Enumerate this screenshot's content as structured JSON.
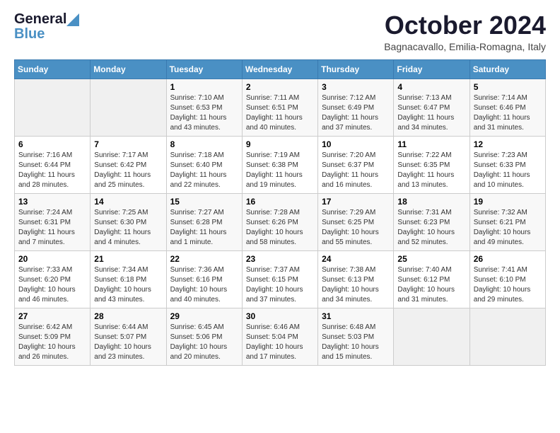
{
  "header": {
    "logo_general": "General",
    "logo_blue": "Blue",
    "month_title": "October 2024",
    "location": "Bagnacavallo, Emilia-Romagna, Italy"
  },
  "days_of_week": [
    "Sunday",
    "Monday",
    "Tuesday",
    "Wednesday",
    "Thursday",
    "Friday",
    "Saturday"
  ],
  "weeks": [
    [
      {
        "day": "",
        "sunrise": "",
        "sunset": "",
        "daylight": ""
      },
      {
        "day": "",
        "sunrise": "",
        "sunset": "",
        "daylight": ""
      },
      {
        "day": "1",
        "sunrise": "Sunrise: 7:10 AM",
        "sunset": "Sunset: 6:53 PM",
        "daylight": "Daylight: 11 hours and 43 minutes."
      },
      {
        "day": "2",
        "sunrise": "Sunrise: 7:11 AM",
        "sunset": "Sunset: 6:51 PM",
        "daylight": "Daylight: 11 hours and 40 minutes."
      },
      {
        "day": "3",
        "sunrise": "Sunrise: 7:12 AM",
        "sunset": "Sunset: 6:49 PM",
        "daylight": "Daylight: 11 hours and 37 minutes."
      },
      {
        "day": "4",
        "sunrise": "Sunrise: 7:13 AM",
        "sunset": "Sunset: 6:47 PM",
        "daylight": "Daylight: 11 hours and 34 minutes."
      },
      {
        "day": "5",
        "sunrise": "Sunrise: 7:14 AM",
        "sunset": "Sunset: 6:46 PM",
        "daylight": "Daylight: 11 hours and 31 minutes."
      }
    ],
    [
      {
        "day": "6",
        "sunrise": "Sunrise: 7:16 AM",
        "sunset": "Sunset: 6:44 PM",
        "daylight": "Daylight: 11 hours and 28 minutes."
      },
      {
        "day": "7",
        "sunrise": "Sunrise: 7:17 AM",
        "sunset": "Sunset: 6:42 PM",
        "daylight": "Daylight: 11 hours and 25 minutes."
      },
      {
        "day": "8",
        "sunrise": "Sunrise: 7:18 AM",
        "sunset": "Sunset: 6:40 PM",
        "daylight": "Daylight: 11 hours and 22 minutes."
      },
      {
        "day": "9",
        "sunrise": "Sunrise: 7:19 AM",
        "sunset": "Sunset: 6:38 PM",
        "daylight": "Daylight: 11 hours and 19 minutes."
      },
      {
        "day": "10",
        "sunrise": "Sunrise: 7:20 AM",
        "sunset": "Sunset: 6:37 PM",
        "daylight": "Daylight: 11 hours and 16 minutes."
      },
      {
        "day": "11",
        "sunrise": "Sunrise: 7:22 AM",
        "sunset": "Sunset: 6:35 PM",
        "daylight": "Daylight: 11 hours and 13 minutes."
      },
      {
        "day": "12",
        "sunrise": "Sunrise: 7:23 AM",
        "sunset": "Sunset: 6:33 PM",
        "daylight": "Daylight: 11 hours and 10 minutes."
      }
    ],
    [
      {
        "day": "13",
        "sunrise": "Sunrise: 7:24 AM",
        "sunset": "Sunset: 6:31 PM",
        "daylight": "Daylight: 11 hours and 7 minutes."
      },
      {
        "day": "14",
        "sunrise": "Sunrise: 7:25 AM",
        "sunset": "Sunset: 6:30 PM",
        "daylight": "Daylight: 11 hours and 4 minutes."
      },
      {
        "day": "15",
        "sunrise": "Sunrise: 7:27 AM",
        "sunset": "Sunset: 6:28 PM",
        "daylight": "Daylight: 11 hours and 1 minute."
      },
      {
        "day": "16",
        "sunrise": "Sunrise: 7:28 AM",
        "sunset": "Sunset: 6:26 PM",
        "daylight": "Daylight: 10 hours and 58 minutes."
      },
      {
        "day": "17",
        "sunrise": "Sunrise: 7:29 AM",
        "sunset": "Sunset: 6:25 PM",
        "daylight": "Daylight: 10 hours and 55 minutes."
      },
      {
        "day": "18",
        "sunrise": "Sunrise: 7:31 AM",
        "sunset": "Sunset: 6:23 PM",
        "daylight": "Daylight: 10 hours and 52 minutes."
      },
      {
        "day": "19",
        "sunrise": "Sunrise: 7:32 AM",
        "sunset": "Sunset: 6:21 PM",
        "daylight": "Daylight: 10 hours and 49 minutes."
      }
    ],
    [
      {
        "day": "20",
        "sunrise": "Sunrise: 7:33 AM",
        "sunset": "Sunset: 6:20 PM",
        "daylight": "Daylight: 10 hours and 46 minutes."
      },
      {
        "day": "21",
        "sunrise": "Sunrise: 7:34 AM",
        "sunset": "Sunset: 6:18 PM",
        "daylight": "Daylight: 10 hours and 43 minutes."
      },
      {
        "day": "22",
        "sunrise": "Sunrise: 7:36 AM",
        "sunset": "Sunset: 6:16 PM",
        "daylight": "Daylight: 10 hours and 40 minutes."
      },
      {
        "day": "23",
        "sunrise": "Sunrise: 7:37 AM",
        "sunset": "Sunset: 6:15 PM",
        "daylight": "Daylight: 10 hours and 37 minutes."
      },
      {
        "day": "24",
        "sunrise": "Sunrise: 7:38 AM",
        "sunset": "Sunset: 6:13 PM",
        "daylight": "Daylight: 10 hours and 34 minutes."
      },
      {
        "day": "25",
        "sunrise": "Sunrise: 7:40 AM",
        "sunset": "Sunset: 6:12 PM",
        "daylight": "Daylight: 10 hours and 31 minutes."
      },
      {
        "day": "26",
        "sunrise": "Sunrise: 7:41 AM",
        "sunset": "Sunset: 6:10 PM",
        "daylight": "Daylight: 10 hours and 29 minutes."
      }
    ],
    [
      {
        "day": "27",
        "sunrise": "Sunrise: 6:42 AM",
        "sunset": "Sunset: 5:09 PM",
        "daylight": "Daylight: 10 hours and 26 minutes."
      },
      {
        "day": "28",
        "sunrise": "Sunrise: 6:44 AM",
        "sunset": "Sunset: 5:07 PM",
        "daylight": "Daylight: 10 hours and 23 minutes."
      },
      {
        "day": "29",
        "sunrise": "Sunrise: 6:45 AM",
        "sunset": "Sunset: 5:06 PM",
        "daylight": "Daylight: 10 hours and 20 minutes."
      },
      {
        "day": "30",
        "sunrise": "Sunrise: 6:46 AM",
        "sunset": "Sunset: 5:04 PM",
        "daylight": "Daylight: 10 hours and 17 minutes."
      },
      {
        "day": "31",
        "sunrise": "Sunrise: 6:48 AM",
        "sunset": "Sunset: 5:03 PM",
        "daylight": "Daylight: 10 hours and 15 minutes."
      },
      {
        "day": "",
        "sunrise": "",
        "sunset": "",
        "daylight": ""
      },
      {
        "day": "",
        "sunrise": "",
        "sunset": "",
        "daylight": ""
      }
    ]
  ]
}
